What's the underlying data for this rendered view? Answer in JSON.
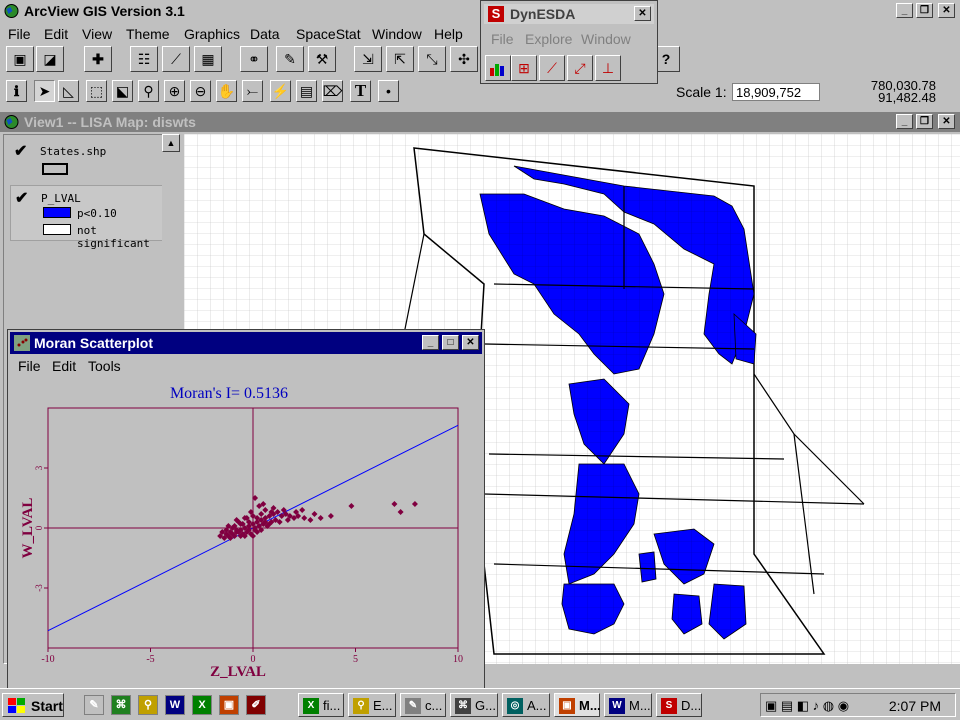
{
  "app": {
    "title": "ArcView GIS Version 3.1",
    "menu": [
      "File",
      "Edit",
      "View",
      "Theme",
      "Graphics",
      "Data",
      "SpaceStat",
      "Window",
      "Help"
    ],
    "scale_label": "Scale 1:",
    "scale_value": "18,909,752",
    "coord_x": "780,030.78",
    "coord_y": "91,482.48"
  },
  "view": {
    "title": "View1 -- LISA Map: diswts",
    "themes": [
      {
        "name": "States.shp"
      },
      {
        "name": "P_LVAL",
        "legend": [
          {
            "label": "p<0.10",
            "color": "#0000ff"
          },
          {
            "label": "not significant",
            "color": "#ffffff"
          }
        ]
      }
    ]
  },
  "dynesda": {
    "icon_letter": "S",
    "title": "DynESDA",
    "menu": [
      "File",
      "Explore",
      "Window"
    ]
  },
  "moran": {
    "title": "Moran Scatterplot",
    "menu": [
      "File",
      "Edit",
      "Tools"
    ]
  },
  "chart_data": {
    "type": "scatter",
    "title": "Moran's I= 0.5136",
    "xlabel": "Z_LVAL",
    "ylabel": "W_LVAL",
    "xlim": [
      -10,
      10
    ],
    "ylim": [
      -6,
      6
    ],
    "xticks": [
      "-10",
      "-5",
      "0",
      "5",
      "10"
    ],
    "yticks": [
      "-3",
      "0",
      "3"
    ],
    "regression": {
      "slope": 0.5136,
      "intercept": 0
    },
    "points": [
      [
        -1.2,
        -0.4
      ],
      [
        -1.0,
        -0.3
      ],
      [
        -0.8,
        -0.2
      ],
      [
        -0.6,
        -0.1
      ],
      [
        -0.4,
        0.0
      ],
      [
        -0.2,
        0.1
      ],
      [
        0,
        0.2
      ],
      [
        0.2,
        0.3
      ],
      [
        0.4,
        0.4
      ],
      [
        0.6,
        0.5
      ],
      [
        0.8,
        0.6
      ],
      [
        1.0,
        0.7
      ],
      [
        1.2,
        0.8
      ],
      [
        1.4,
        0.6
      ],
      [
        1.6,
        0.7
      ],
      [
        1.8,
        0.6
      ],
      [
        2.0,
        0.5
      ],
      [
        2.2,
        0.6
      ],
      [
        2.5,
        0.5
      ],
      [
        2.8,
        0.4
      ],
      [
        3.3,
        0.5
      ],
      [
        -1.4,
        -0.5
      ],
      [
        -1.1,
        -0.2
      ],
      [
        -0.9,
        0.1
      ],
      [
        -0.7,
        0.3
      ],
      [
        -0.5,
        0.2
      ],
      [
        -0.3,
        -0.2
      ],
      [
        -0.1,
        -0.3
      ],
      [
        0.1,
        0.0
      ],
      [
        0.3,
        0.1
      ],
      [
        0.5,
        0.2
      ],
      [
        0.7,
        0.1
      ],
      [
        0.9,
        0.3
      ],
      [
        1.1,
        0.4
      ],
      [
        -1.3,
        -0.3
      ],
      [
        -1.0,
        0.0
      ],
      [
        -0.8,
        0.4
      ],
      [
        -0.6,
        -0.4
      ],
      [
        -0.4,
        0.5
      ],
      [
        -0.2,
        -0.1
      ],
      [
        0.0,
        0.6
      ],
      [
        0.2,
        -0.2
      ],
      [
        0.4,
        0.7
      ],
      [
        0.6,
        0.9
      ],
      [
        0.8,
        0.2
      ],
      [
        1.0,
        1.0
      ],
      [
        1.3,
        0.3
      ],
      [
        0.1,
        1.5
      ],
      [
        0.3,
        1.1
      ],
      [
        0.5,
        1.2
      ],
      [
        -0.1,
        0.8
      ],
      [
        -0.3,
        0.5
      ],
      [
        -1.5,
        -0.2
      ],
      [
        -1.2,
        0.1
      ],
      [
        -0.9,
        -0.4
      ],
      [
        -0.7,
        -0.2
      ],
      [
        -0.5,
        -0.3
      ],
      [
        0.0,
        -0.4
      ],
      [
        0.2,
        0.5
      ],
      [
        0.4,
        -0.1
      ],
      [
        0.6,
        0.3
      ],
      [
        0.9,
        0.8
      ],
      [
        1.5,
        0.9
      ],
      [
        1.7,
        0.4
      ],
      [
        2.1,
        0.8
      ],
      [
        2.4,
        0.9
      ],
      [
        3.0,
        0.7
      ],
      [
        4.8,
        1.1
      ],
      [
        6.9,
        1.2
      ],
      [
        7.9,
        1.2
      ],
      [
        7.2,
        0.8
      ],
      [
        3.8,
        0.6
      ],
      [
        -1.6,
        -0.4
      ],
      [
        -1.3,
        -0.1
      ],
      [
        -1.1,
        -0.5
      ],
      [
        -0.8,
        -0.1
      ],
      [
        -0.6,
        0.2
      ],
      [
        -0.4,
        -0.4
      ],
      [
        -0.2,
        0.3
      ],
      [
        0.1,
        -0.1
      ]
    ]
  },
  "taskbar": {
    "start_label": "Start",
    "quick_icons": [
      "✎",
      "⌘",
      "⚲",
      "W",
      "X",
      "▣",
      "✐"
    ],
    "tasks": [
      {
        "label": "fi...",
        "icon": "X",
        "color": "#008000"
      },
      {
        "label": "E...",
        "icon": "⚲",
        "color": "#c0a000"
      },
      {
        "label": "c...",
        "icon": "✎",
        "color": "#808080"
      },
      {
        "label": "G...",
        "icon": "⌘",
        "color": "#404040"
      },
      {
        "label": "A...",
        "icon": "◎",
        "color": "#006060"
      },
      {
        "label": "M...",
        "icon": "▣",
        "color": "#c04000"
      },
      {
        "label": "M...",
        "icon": "W",
        "color": "#000080"
      },
      {
        "label": "D...",
        "icon": "S",
        "color": "#c00000"
      }
    ],
    "clock": "2:07 PM"
  }
}
